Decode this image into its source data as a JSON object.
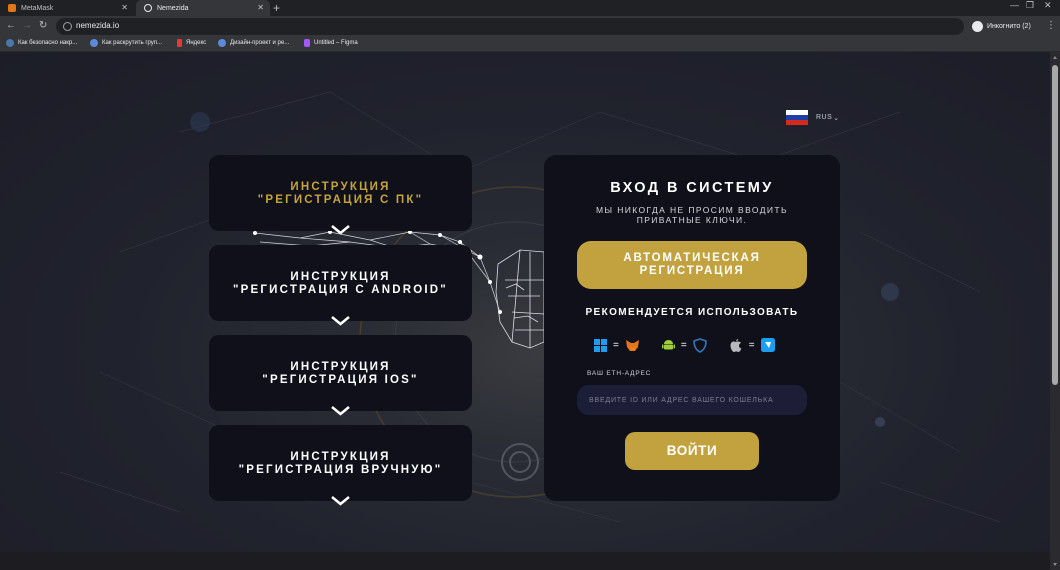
{
  "browser": {
    "tabs": [
      {
        "title": "MetaMask",
        "active": false,
        "favicon_color": "#e2761b"
      },
      {
        "title": "Nemezida",
        "active": true,
        "favicon_color": "#e8eaed"
      }
    ],
    "url": "nemezida.io",
    "profile_label": "Инкогнито (2)",
    "bookmarks": [
      {
        "label": "Как безопасно накр...",
        "icon_color": "#4a76a8"
      },
      {
        "label": "Как раскрутить груп...",
        "icon_color": "#5b8bd6"
      },
      {
        "label": "Яндекс",
        "icon_color": "#e53935"
      },
      {
        "label": "Дизайн-проект и ре...",
        "icon_color": "#5b8bd6"
      },
      {
        "label": "Untitled – Figma",
        "icon_color": "#a259ff"
      }
    ]
  },
  "language": {
    "code": "RUS",
    "chevron": "⌄"
  },
  "instructions": [
    {
      "line1": "ИНСТРУКЦИЯ",
      "line2": "\"РЕГИСТРАЦИЯ С ПК\"",
      "highlighted": true
    },
    {
      "line1": "ИНСТРУКЦИЯ",
      "line2": "\"РЕГИСТРАЦИЯ С ANDROID\"",
      "highlighted": false
    },
    {
      "line1": "ИНСТРУКЦИЯ",
      "line2": "\"РЕГИСТРАЦИЯ IOS\"",
      "highlighted": false
    },
    {
      "line1": "ИНСТРУКЦИЯ",
      "line2": "\"РЕГИСТРАЦИЯ ВРУЧНУЮ\"",
      "highlighted": false
    }
  ],
  "login": {
    "title": "ВХОД В СИСТЕМУ",
    "subtitle_line1": "МЫ НИКОГДА НЕ ПРОСИМ ВВОДИТЬ",
    "subtitle_line2": "ПРИВАТНЫЕ КЛЮЧИ.",
    "auto_button_line1": "АВТОМАТИЧЕСКАЯ",
    "auto_button_line2": "РЕГИСТРАЦИЯ",
    "recommend_label": "РЕКОМЕНДУЕТСЯ ИСПОЛЬЗОВАТЬ",
    "platform_pairs": [
      {
        "platform_icon": "windows-icon",
        "wallet_icon": "metamask-icon"
      },
      {
        "platform_icon": "android-icon",
        "wallet_icon": "trust-wallet-icon"
      },
      {
        "platform_icon": "apple-icon",
        "wallet_icon": "wallet-app-icon"
      }
    ],
    "equals": "=",
    "eth_label": "ВАШ ETH-АДРЕС",
    "eth_placeholder": "ВВЕДИТЕ ID ИЛИ АДРЕС ВАШЕГО КОШЕЛЬКА",
    "submit_label": "ВОЙТИ"
  },
  "colors": {
    "gold": "#c2a23f",
    "panel": "#0f101a",
    "input_bg": "#1b1e36",
    "page_bg": "#20222d"
  }
}
